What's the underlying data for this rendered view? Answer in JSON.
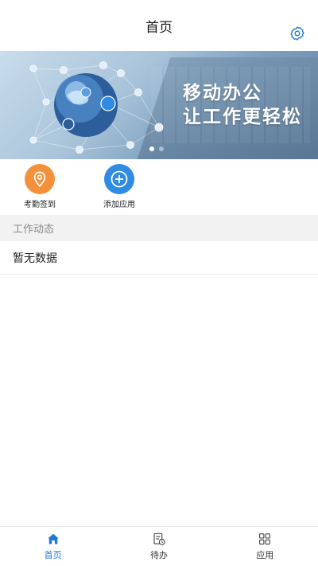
{
  "header": {
    "title": "首页"
  },
  "banner": {
    "line1": "移动办公",
    "line2": "让工作更轻松",
    "slide_count": 2,
    "active_slide": 1
  },
  "quick_actions": [
    {
      "label": "考勤签到",
      "icon": "location-pin-icon",
      "color": "#f2913a"
    },
    {
      "label": "添加应用",
      "icon": "plus-circle-icon",
      "color": "#2f8be4"
    }
  ],
  "section": {
    "title": "工作动态",
    "empty_text": "暂无数据"
  },
  "tabs": [
    {
      "label": "首页",
      "icon": "home-icon",
      "active": true
    },
    {
      "label": "待办",
      "icon": "todo-icon",
      "active": false
    },
    {
      "label": "应用",
      "icon": "apps-icon",
      "active": false
    }
  ],
  "colors": {
    "accent": "#1f78d1",
    "section_bg": "#f2f2f2"
  }
}
